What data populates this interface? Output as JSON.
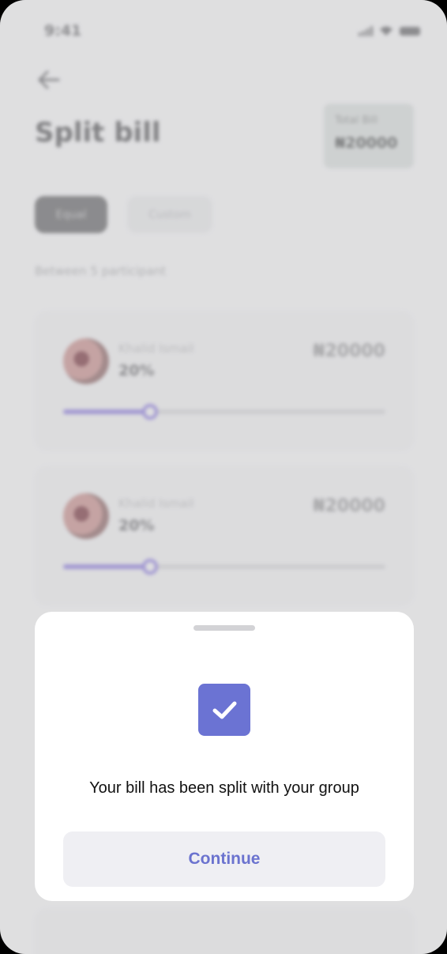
{
  "status_bar": {
    "time": "9:41"
  },
  "header": {
    "title": "Split bill",
    "back_icon": "arrow-left-icon"
  },
  "total": {
    "label": "Total Bill",
    "value": "₦20000"
  },
  "tabs": [
    {
      "label": "Equal",
      "active": true
    },
    {
      "label": "Custom",
      "active": false
    }
  ],
  "participants_label": "Between 5 participant",
  "participants": [
    {
      "name": "Khalid Ismail",
      "percent": "20%",
      "amount": "₦20000",
      "progress": 0.27
    },
    {
      "name": "Khalid Ismail",
      "percent": "20%",
      "amount": "₦20000",
      "progress": 0.27
    }
  ],
  "sheet": {
    "icon": "checkmark-icon",
    "message": "Your bill has been split with your group",
    "continue_label": "Continue"
  },
  "colors": {
    "accent": "#6b73d3",
    "slider": "#8e7fd6",
    "background": "#ebebec",
    "sheet": "#ffffff"
  }
}
